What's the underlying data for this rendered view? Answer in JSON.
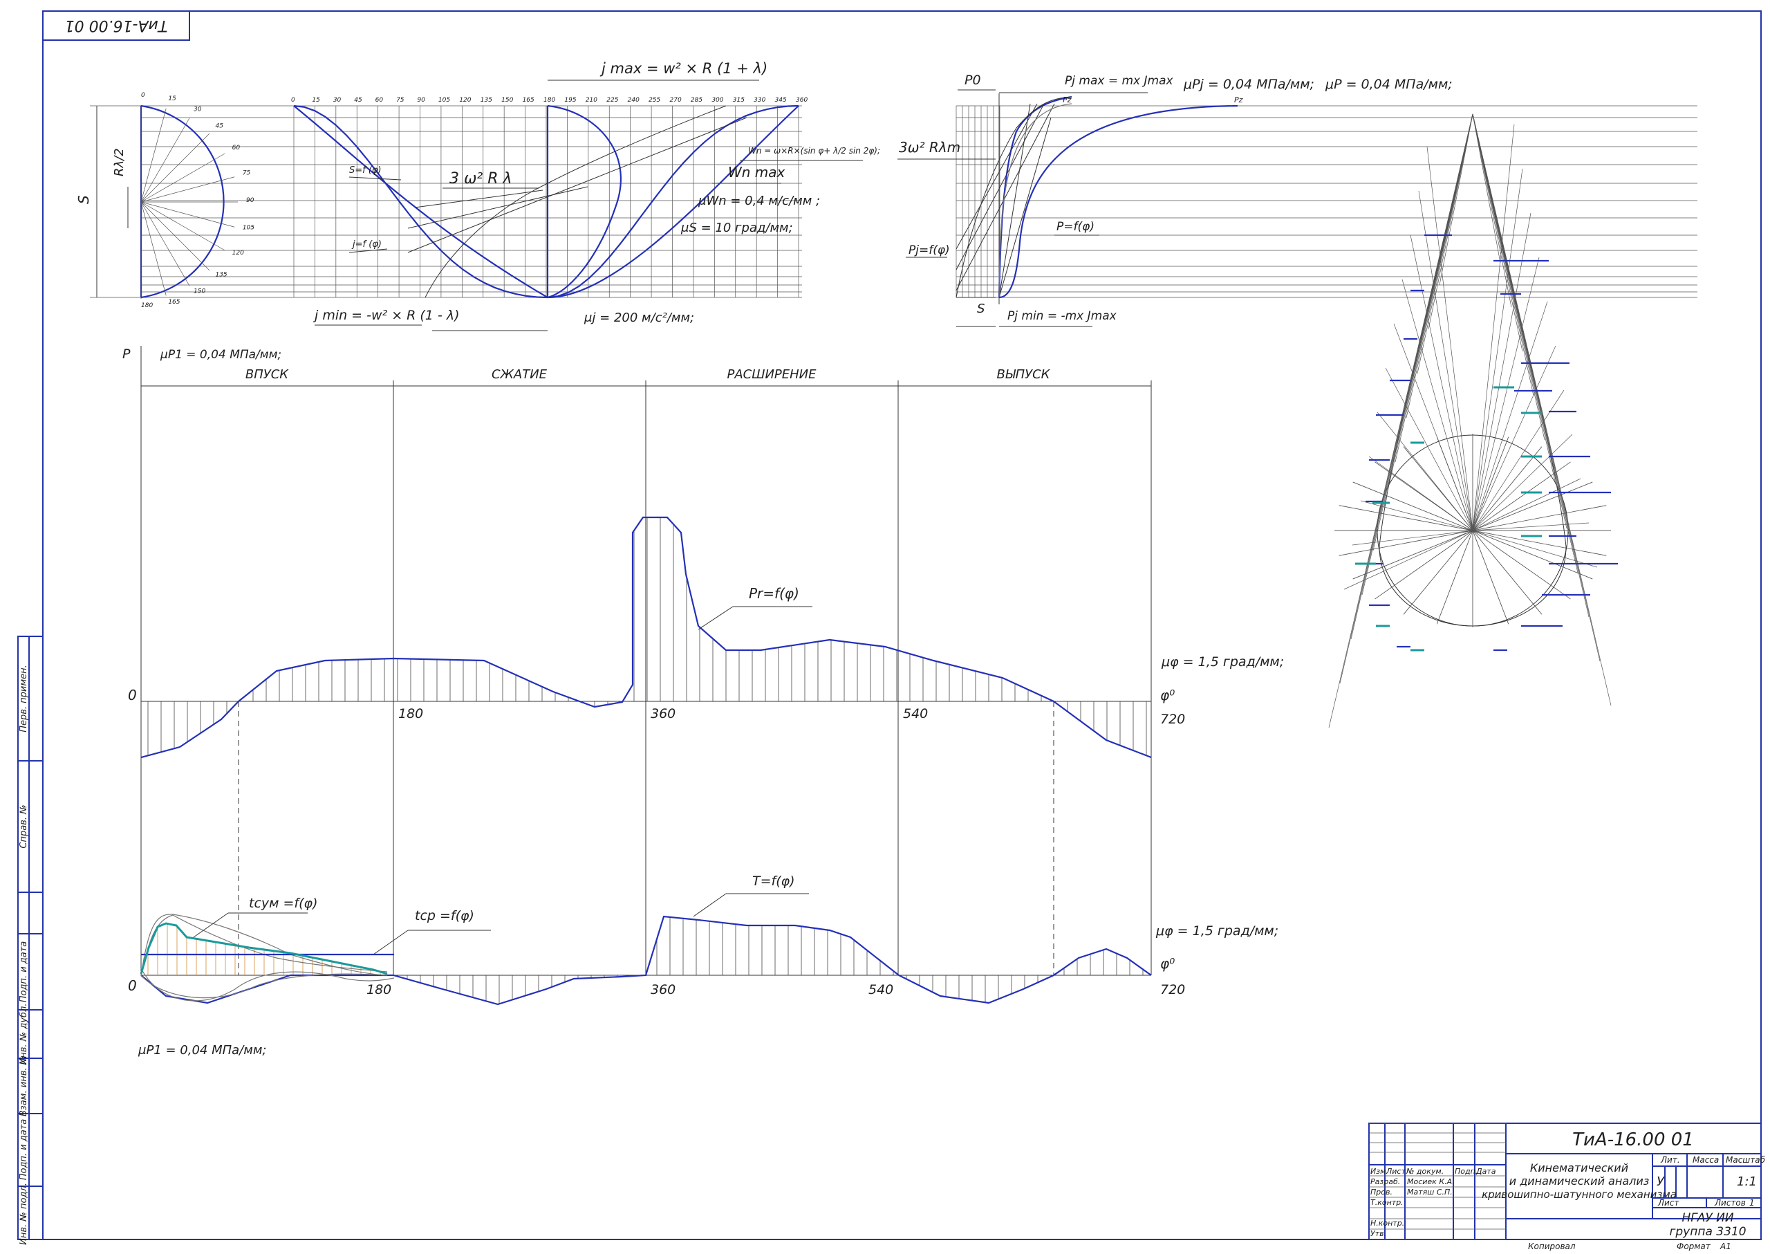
{
  "stamp_code": "ТиА-16.00 01",
  "top_labels": {
    "jmax": "j max = w² × R (1 + λ)",
    "jmin": "j min = -w² × R (1 - λ)",
    "S": "S",
    "rl2": "Rλ/2",
    "s_f": "S=f (φ)",
    "j_f": "j=f (φ)",
    "three_omega": "3 ω² R λ",
    "wn_formula": "Wn = ω×R×(sin φ+ λ/2 sin 2φ);",
    "wn_max": "Wn max",
    "mu_wn": "μWn = 0,4 м/с/мм ;",
    "mu_s": "μS = 10 град/мм;",
    "mu_j": "μj = 200 м/с²/мм;",
    "p0": "P0",
    "pj_max": "Pj max = mx Jmax",
    "pj_min": "Pj min = -mx Jmax",
    "mu_pj": "μPj = 0,04 МПа/мм;",
    "mu_p": "μP = 0,04 МПа/мм;",
    "three_omega_m": "3ω² Rλm",
    "pj_f": "Pj=f(φ)",
    "p_f": "P=f(φ)",
    "pz": "Pz",
    "s2": "S"
  },
  "crank_ticks": [
    "0",
    "15",
    "30",
    "45",
    "60",
    "75",
    "90",
    "105",
    "120",
    "135",
    "150",
    "165",
    "180",
    "195",
    "210",
    "225",
    "240",
    "255",
    "270",
    "285",
    "300",
    "315",
    "330",
    "345",
    "360"
  ],
  "semicircle_ticks": [
    "0",
    "15",
    "30",
    "45",
    "60",
    "75",
    "90",
    "105",
    "120",
    "135",
    "150",
    "165",
    "180"
  ],
  "mid_chart": {
    "p_axis": "P",
    "mu_top": "μP1 = 0,04 МПа/мм;",
    "strokes": [
      "ВПУСК",
      "СЖАТИЕ",
      "РАСШИРЕНИЕ",
      "ВЫПУСК"
    ],
    "zero": "0",
    "ticks": [
      "180",
      "360",
      "540",
      "720"
    ],
    "phi": "φ⁰",
    "mu_phi": "μφ = 1,5 град/мм;",
    "pr_label": "Pr=f(φ)"
  },
  "bottom_chart": {
    "zero": "0",
    "ticks": [
      "180",
      "360",
      "540",
      "720"
    ],
    "phi": "φ⁰",
    "mu_phi": "μφ = 1,5 град/мм;",
    "t_label": "T=f(φ)",
    "tsum_label": "tсум =f(φ)",
    "tcp_label": "tср =f(φ)",
    "mu_p1": "μP1 = 0,04 МПа/мм;"
  },
  "side_column": [
    "Перв. примен.",
    "Справ. №",
    "Подп. и дата",
    "Инв. № дубл.",
    "Взам. инв. №",
    "Подп. и дата",
    "Инв. № подл."
  ],
  "title_block": {
    "code": "ТиА-16.00 01",
    "title": [
      "Кинематический",
      "и динамический анализ",
      "кривошипно-шатунного механизма"
    ],
    "hdr": [
      "Изм.",
      "Лист",
      "№ докум.",
      "Подп.",
      "Дата"
    ],
    "rows": [
      {
        "role": "Разраб.",
        "name": "Мосиек К.А."
      },
      {
        "role": "Пров.",
        "name": "Матяш С.П."
      },
      {
        "role": "Т.контр.",
        "name": ""
      },
      {
        "role": "",
        "name": ""
      },
      {
        "role": "Н.контр.",
        "name": ""
      },
      {
        "role": "Утв.",
        "name": ""
      }
    ],
    "lit": "Лит.",
    "mass": "Масса",
    "scale": "Масштаб",
    "lit_val": "У",
    "scale_val": "1:1",
    "sheet": "Лист",
    "sheets": "Листов",
    "sheets_val": "1",
    "org": [
      "НГАУ ИИ",
      "группа 3310"
    ],
    "copied": "Копировал",
    "format": "Формат",
    "format_val": "А1"
  }
}
